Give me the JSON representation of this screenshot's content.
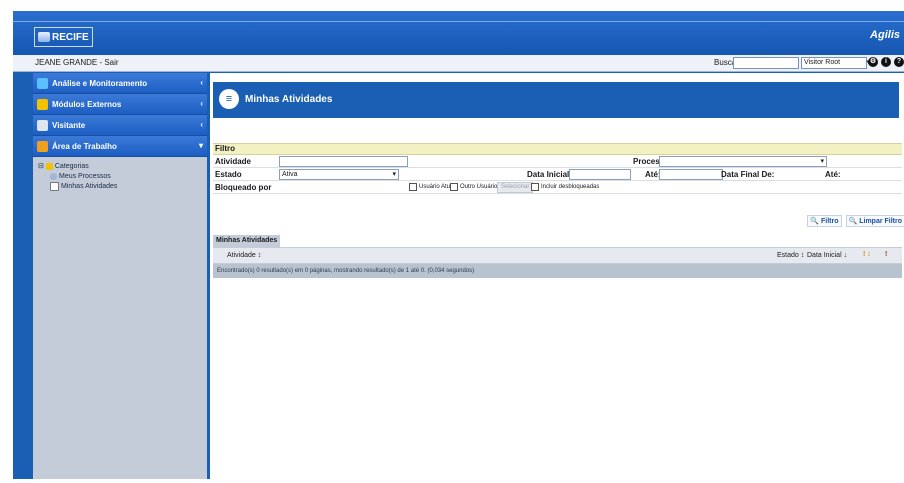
{
  "header": {
    "logo_text": "RECIFE",
    "brand_right": "Agilis"
  },
  "userbar": {
    "user_label": "JEANE GRANDE  -  Sair",
    "busca_label": "Busca",
    "busca_value": "",
    "role_value": "Visitor Root"
  },
  "sidebar": {
    "nav": [
      {
        "label": "Análise e Monitoramento",
        "icon": "chart-icon"
      },
      {
        "label": "Módulos Externos",
        "icon": "puzzle-icon"
      },
      {
        "label": "Visitante",
        "icon": "visitor-icon"
      },
      {
        "label": "Área de Trabalho",
        "icon": "desk-icon"
      }
    ],
    "tree": {
      "root": "Categorias",
      "items": [
        "Meus Processos",
        "Minhas Atividades"
      ]
    }
  },
  "page": {
    "title": "Minhas Atividades"
  },
  "filter": {
    "header": "Filtro",
    "atividade_label": "Atividade",
    "atividade_value": "",
    "processo_label": "Processo",
    "processo_value": "",
    "estado_label": "Estado",
    "estado_value": "Ativa",
    "data_inicial_de_label": "Data Inicial De:",
    "ate_label_1": "Até:",
    "data_final_de_label": "Data Final De:",
    "ate_label_2": "Até:",
    "bloqueado_label": "Bloqueado por",
    "usuario_atual": "Usuário Atual",
    "outro_usuario": "Outro Usuário",
    "selecionar": "Selecionar",
    "incluir_desbloqueadas": "Incluir desbloqueadas"
  },
  "actions": {
    "filtro": "Filtro",
    "limpar": "Limpar Filtro"
  },
  "list": {
    "title": "Minhas Atividades",
    "col_atividade": "Atividade ↕",
    "col_estado": "Estado ↕",
    "col_data_inicial": "Data Inicial ↓",
    "col_priority": "! ↕",
    "col_lock": "!",
    "footer": "Encontrado(s) 0 resultado(s) em 0 páginas, mostrando resultado(s) de 1 até 0. (0,034 segundos)"
  },
  "colors": {
    "accent": "#1a5fb4",
    "sidebar": "#c3ccd8",
    "filter_header": "#f3f1c2"
  }
}
